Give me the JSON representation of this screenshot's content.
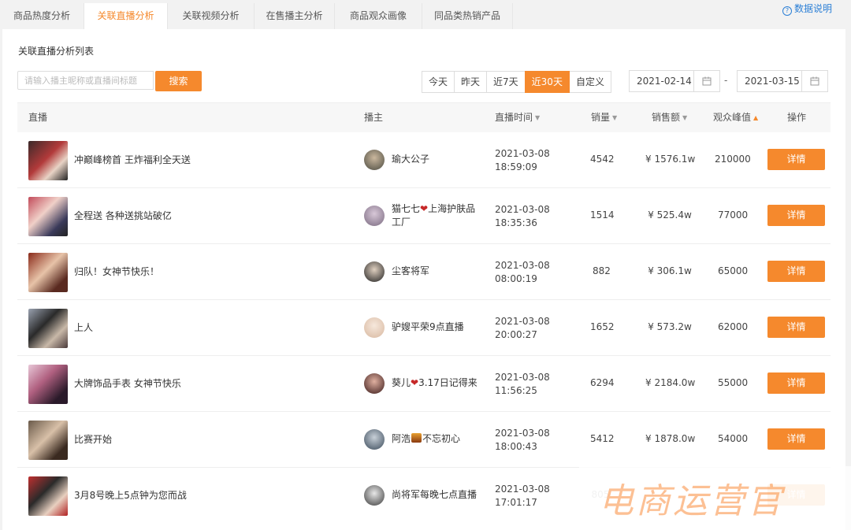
{
  "tabs": [
    {
      "label": "商品热度分析"
    },
    {
      "label": "关联直播分析"
    },
    {
      "label": "关联视频分析"
    },
    {
      "label": "在售播主分析"
    },
    {
      "label": "商品观众画像"
    },
    {
      "label": "同品类热销产品"
    }
  ],
  "help_label": "数据说明",
  "list_title": "关联直播分析列表",
  "search": {
    "placeholder": "请输入播主昵称或直播间标题",
    "button": "搜索"
  },
  "ranges": [
    "今天",
    "昨天",
    "近7天",
    "近30天",
    "自定义"
  ],
  "active_range": "近30天",
  "date_start": "2021-02-14",
  "date_sep": "-",
  "date_end": "2021-03-15",
  "columns": {
    "live": "直播",
    "anchor": "播主",
    "time": "直播时间",
    "sales": "销量",
    "amount": "销售额",
    "peak": "观众峰值",
    "action": "操作"
  },
  "rows": [
    {
      "title": "冲巅峰榜首 王炸福利全天送",
      "anchor": "瑜大公子",
      "date": "2021-03-08",
      "clock": "18:59:09",
      "sales": "4542",
      "amount": "¥ 1576.1w",
      "peak": "210000",
      "action": "详情"
    },
    {
      "title": "全程送 各种送挑站破亿",
      "anchor_a": "猫七七",
      "anchor_b": "上海护肤品",
      "anchor_c": "工厂",
      "date": "2021-03-08",
      "clock": "18:35:36",
      "sales": "1514",
      "amount": "¥ 525.4w",
      "peak": "77000",
      "action": "详情"
    },
    {
      "title": "归队！女神节快乐！",
      "anchor": "尘客将军",
      "date": "2021-03-08",
      "clock": "08:00:19",
      "sales": "882",
      "amount": "¥ 306.1w",
      "peak": "65000",
      "action": "详情"
    },
    {
      "title": "上人",
      "anchor": "驴嫂平荣9点直播",
      "date": "2021-03-08",
      "clock": "20:00:27",
      "sales": "1652",
      "amount": "¥ 573.2w",
      "peak": "62000",
      "action": "详情"
    },
    {
      "title": "大牌饰品手表 女神节快乐",
      "anchor_a": "葵儿",
      "anchor_b": "3.17日记得来",
      "date": "2021-03-08",
      "clock": "11:56:25",
      "sales": "6294",
      "amount": "¥ 2184.0w",
      "peak": "55000",
      "action": "详情"
    },
    {
      "title": "比赛开始",
      "anchor_a": "阿浩",
      "anchor_b": "不忘初心",
      "date": "2021-03-08",
      "clock": "18:00:43",
      "sales": "5412",
      "amount": "¥ 1878.0w",
      "peak": "54000",
      "action": "详情"
    },
    {
      "title": "3月8号晚上5点钟为您而战",
      "anchor": "尚将军每晚七点直播",
      "date": "2021-03-08",
      "clock": "17:01:17",
      "sales": "805",
      "action": "详情"
    }
  ],
  "watermark": "电商运营官",
  "colors": {
    "accent": "#f5892d",
    "link": "#2b7fd6"
  }
}
